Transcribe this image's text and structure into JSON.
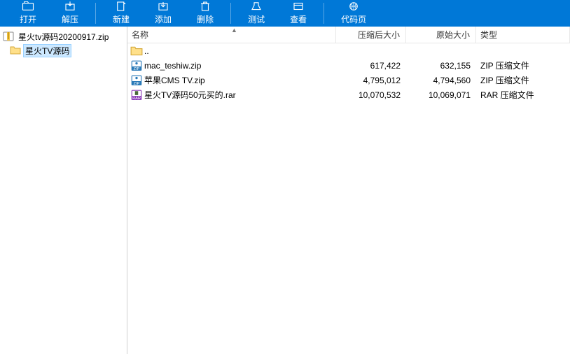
{
  "toolbar": {
    "open": "打开",
    "extract": "解压",
    "new": "新建",
    "add": "添加",
    "delete": "删除",
    "test": "测试",
    "view": "查看",
    "codepage": "代码页"
  },
  "sidebar": {
    "root": "星火tv源码20200917.zip",
    "child": "星火TV源码"
  },
  "columns": {
    "name": "名称",
    "compressed": "压缩后大小",
    "original": "原始大小",
    "type": "类型"
  },
  "rows": [
    {
      "icon": "folder",
      "name": "..",
      "compressed": "",
      "original": "",
      "type": ""
    },
    {
      "icon": "zip",
      "name": "mac_teshiw.zip",
      "compressed": "617,422",
      "original": "632,155",
      "type": "ZIP 压缩文件"
    },
    {
      "icon": "zip",
      "name": "苹果CMS TV.zip",
      "compressed": "4,795,012",
      "original": "4,794,560",
      "type": "ZIP 压缩文件"
    },
    {
      "icon": "rar",
      "name": "星火TV源码50元买的.rar",
      "compressed": "10,070,532",
      "original": "10,069,071",
      "type": "RAR 压缩文件"
    }
  ]
}
